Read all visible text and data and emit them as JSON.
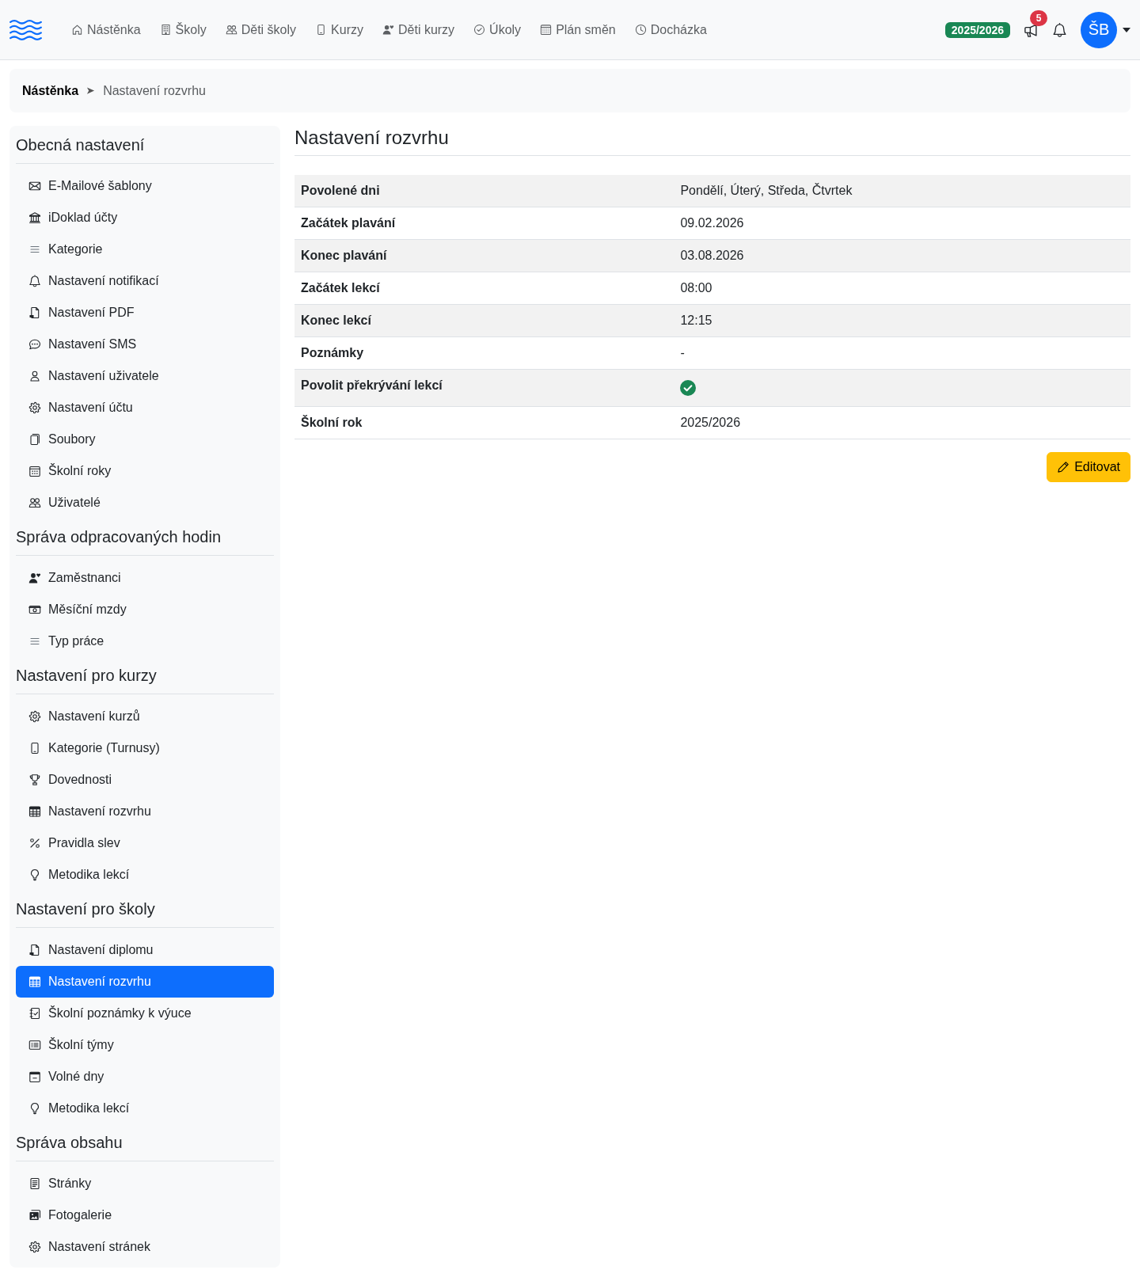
{
  "navbar": {
    "links": [
      "Nástěnka",
      "Školy",
      "Děti školy",
      "Kurzy",
      "Děti kurzy",
      "Úkoly",
      "Plán směn",
      "Docházka"
    ],
    "school_year": "2025/2026",
    "announcements_count": "5",
    "avatar_initials": "ŠB"
  },
  "breadcrumb": [
    "Nástěnka",
    "Nastavení rozvrhu"
  ],
  "sidebar": {
    "sections": [
      {
        "title": "Obecná nastavení",
        "items": [
          {
            "label": "E-Mailové šablony",
            "selected": false
          },
          {
            "label": "iDoklad účty",
            "selected": false
          },
          {
            "label": "Kategorie",
            "selected": false
          },
          {
            "label": "Nastavení notifikací",
            "selected": false
          },
          {
            "label": "Nastavení PDF",
            "selected": false
          },
          {
            "label": "Nastavení SMS",
            "selected": false
          },
          {
            "label": "Nastavení uživatele",
            "selected": false
          },
          {
            "label": "Nastavení účtu",
            "selected": false
          },
          {
            "label": "Soubory",
            "selected": false
          },
          {
            "label": "Školní roky",
            "selected": false
          },
          {
            "label": "Uživatelé",
            "selected": false
          }
        ]
      },
      {
        "title": "Správa odpracovaných hodin",
        "items": [
          {
            "label": "Zaměstnanci",
            "selected": false
          },
          {
            "label": "Měsíční mzdy",
            "selected": false
          },
          {
            "label": "Typ práce",
            "selected": false
          }
        ]
      },
      {
        "title": "Nastavení pro kurzy",
        "items": [
          {
            "label": "Nastavení kurzů",
            "selected": false
          },
          {
            "label": "Kategorie (Turnusy)",
            "selected": false
          },
          {
            "label": "Dovednosti",
            "selected": false
          },
          {
            "label": "Nastavení rozvrhu",
            "selected": false
          },
          {
            "label": "Pravidla slev",
            "selected": false
          },
          {
            "label": "Metodika lekcí",
            "selected": false
          }
        ]
      },
      {
        "title": "Nastavení pro školy",
        "items": [
          {
            "label": "Nastavení diplomu",
            "selected": false
          },
          {
            "label": "Nastavení rozvrhu",
            "selected": true
          },
          {
            "label": "Školní poznámky k výuce",
            "selected": false
          },
          {
            "label": "Školní týmy",
            "selected": false
          },
          {
            "label": "Volné dny",
            "selected": false
          },
          {
            "label": "Metodika lekcí",
            "selected": false
          }
        ]
      },
      {
        "title": "Správa obsahu",
        "items": [
          {
            "label": "Stránky",
            "selected": false
          },
          {
            "label": "Fotogalerie",
            "selected": false
          },
          {
            "label": "Nastavení stránek",
            "selected": false
          }
        ]
      }
    ]
  },
  "page": {
    "title": "Nastavení rozvrhu",
    "rows": [
      {
        "kind": "text",
        "label": "Povolené dni",
        "value": "Pondělí, Úterý, Středa, Čtvrtek"
      },
      {
        "kind": "text",
        "label": "Začátek plavání",
        "value": "09.02.2026"
      },
      {
        "kind": "text",
        "label": "Konec plavání",
        "value": "03.08.2026"
      },
      {
        "kind": "text",
        "label": "Začátek lekcí",
        "value": "08:00"
      },
      {
        "kind": "text",
        "label": "Konec lekcí",
        "value": "12:15"
      },
      {
        "kind": "text",
        "label": "Poznámky",
        "value": "-"
      },
      {
        "kind": "check",
        "label": "Povolit překrývání lekcí",
        "checked": true
      },
      {
        "kind": "text",
        "label": "Školní rok",
        "value": "2025/2026"
      }
    ],
    "edit_button": "Editovat"
  }
}
